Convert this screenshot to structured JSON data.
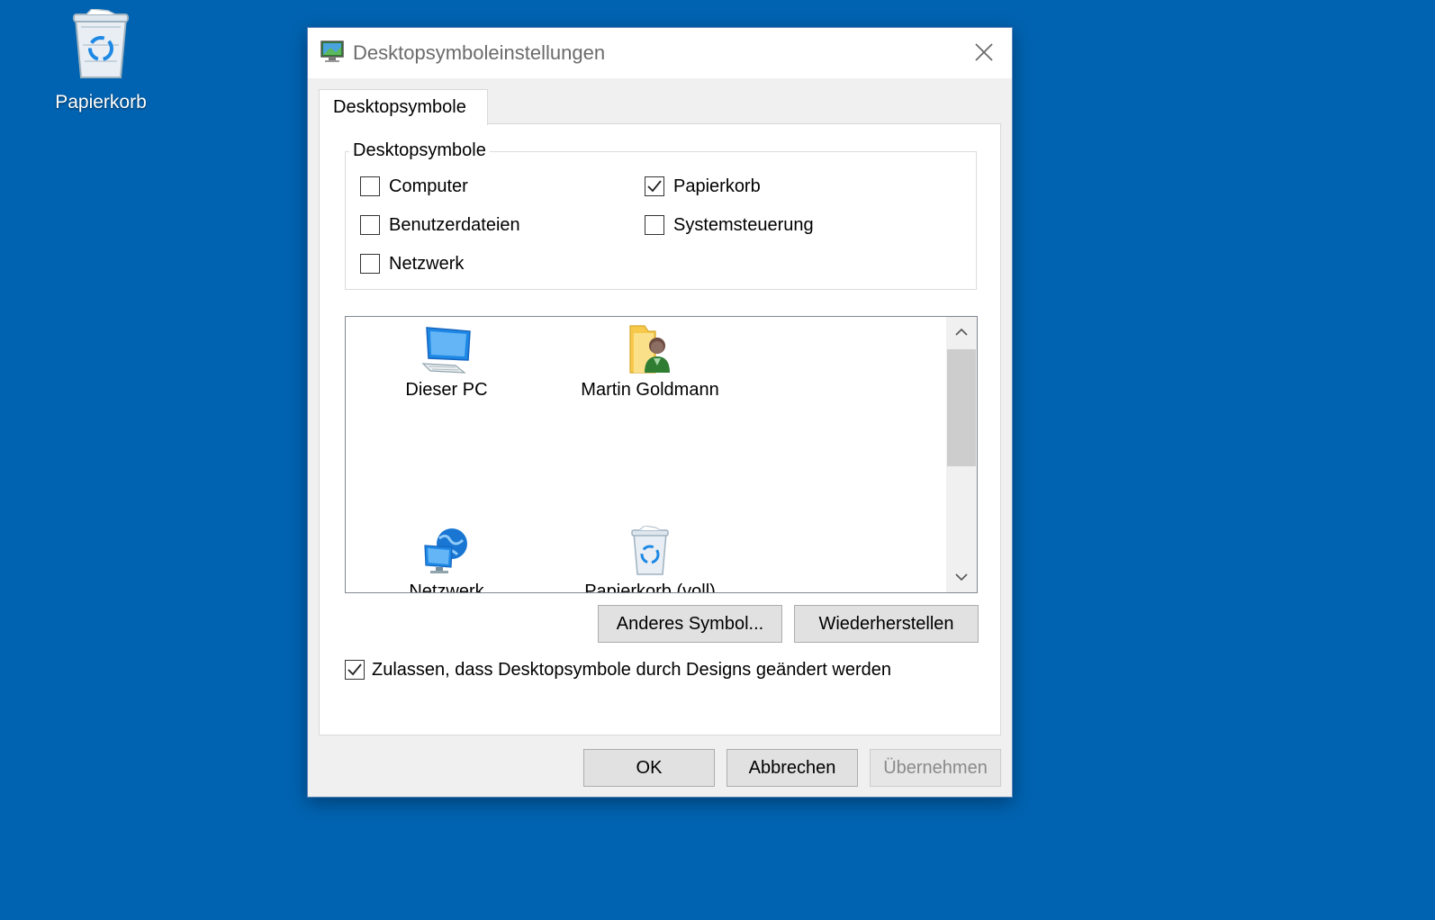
{
  "desktop": {
    "recycle_bin_label": "Papierkorb"
  },
  "dialog": {
    "title": "Desktopsymboleinstellungen",
    "tab_label": "Desktopsymbole",
    "group_title": "Desktopsymbole",
    "checkboxes": [
      {
        "label": "Computer",
        "checked": false
      },
      {
        "label": "Papierkorb",
        "checked": true
      },
      {
        "label": "Benutzerdateien",
        "checked": false
      },
      {
        "label": "Systemsteuerung",
        "checked": false
      },
      {
        "label": "Netzwerk",
        "checked": false
      }
    ],
    "icons": [
      {
        "label": "Dieser PC",
        "icon": "computer-icon"
      },
      {
        "label": "Martin Goldmann",
        "icon": "user-folder-icon"
      },
      {
        "label": "Netzwerk",
        "icon": "network-icon"
      },
      {
        "label": "Papierkorb (voll)",
        "icon": "recycle-bin-full-icon"
      }
    ],
    "change_icon_label": "Anderes Symbol...",
    "restore_label": "Wiederherstellen",
    "allow_themes": {
      "label": "Zulassen, dass Desktopsymbole durch Designs geändert werden",
      "checked": true
    },
    "ok_label": "OK",
    "cancel_label": "Abbrechen",
    "apply_label": "Übernehmen"
  },
  "colors": {
    "desktop_bg": "#0063b1",
    "dialog_bg": "#f0f0f0",
    "button_bg": "#e1e1e1"
  }
}
